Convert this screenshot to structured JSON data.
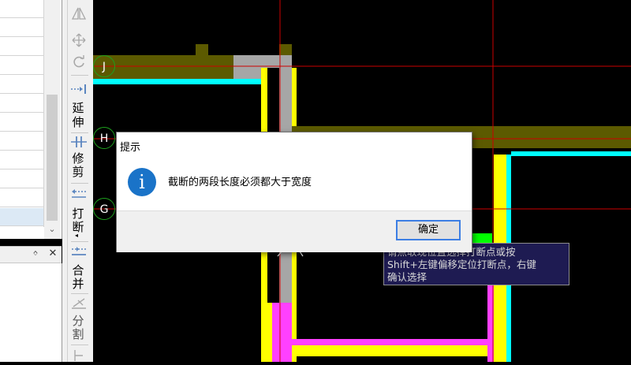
{
  "left_panel": {
    "list_rows": [
      "",
      "",
      "",
      "",
      "",
      "",
      "",
      "",
      "",
      "",
      "",
      ""
    ],
    "selected_row": 11,
    "scroll_down_arrow": "⌄",
    "pin_glyph": "ᛜ",
    "close_glyph": "✕"
  },
  "toolbar": {
    "icons": {
      "mirror": "mirror-icon",
      "move": "move-icon",
      "rotate": "rotate-icon",
      "extend": "extend-icon",
      "trim": "trim-icon",
      "break": "break-icon",
      "merge": "merge-icon",
      "split": "split-icon"
    },
    "extend_label_1": "延",
    "extend_label_2": "伸",
    "trim_label_1": "修",
    "trim_label_2": "剪",
    "break_label_1": "打",
    "break_label_2": "断",
    "merge_label_1": "合",
    "merge_label_2": "并",
    "split_label_1": "分",
    "split_label_2": "割"
  },
  "canvas": {
    "axis_labels": [
      "J",
      "H",
      "G"
    ],
    "colors": {
      "wall_olive": "#5c5a00",
      "wall_gray": "#a6a6a6",
      "cyan": "#00ffff",
      "yellow": "#ffff00",
      "magenta": "#ff40ff",
      "green": "#00ff00",
      "axis_red": "#cc0000",
      "bubble_green": "#1ea01e"
    }
  },
  "dialog": {
    "title": "提示",
    "message": "截断的两段长度必须都大于宽度",
    "ok_label": "确定",
    "icon": "info-icon"
  },
  "tooltip": {
    "line1": "请点取现位置选择打断点或按",
    "line2": "Shift+左键偏移定位打断点，右键",
    "line3": "确认选择"
  }
}
